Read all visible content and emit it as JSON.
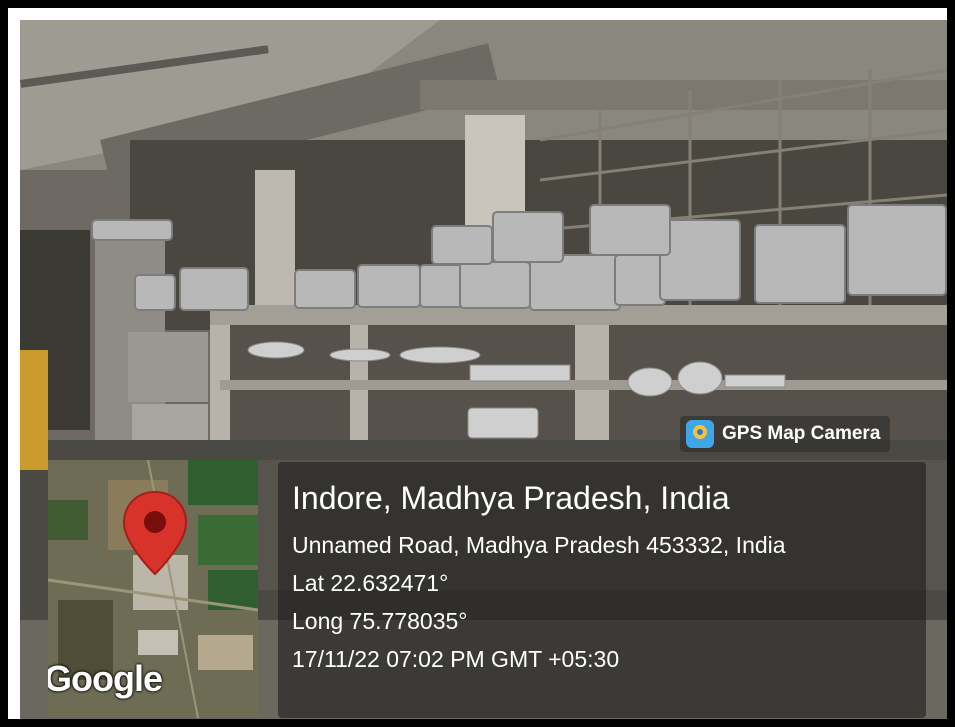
{
  "watermark": {
    "app_name": "GPS Map Camera",
    "icon": "gps-map-camera-app-icon"
  },
  "map": {
    "provider": "Google",
    "marker_icon": "location-pin-icon",
    "marker_color": "#d7332b"
  },
  "location": {
    "title": "Indore, Madhya Pradesh, India",
    "address": "Unnamed Road, Madhya Pradesh 453332, India",
    "latitude": "Lat 22.632471°",
    "longitude": "Long 75.778035°",
    "datetime": "17/11/22 07:02 PM GMT +05:30"
  }
}
